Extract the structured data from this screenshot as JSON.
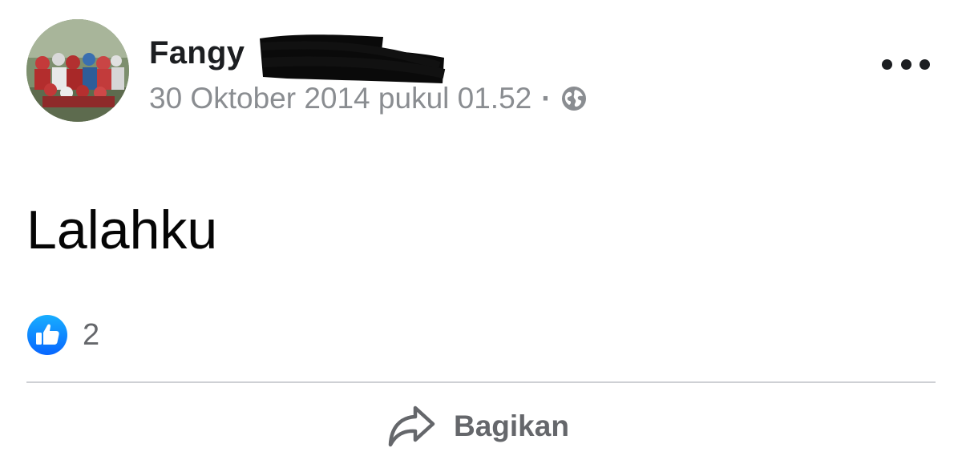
{
  "post": {
    "author": {
      "name": "Fangy"
    },
    "meta": {
      "timestamp": "30 Oktober 2014 pukul 01.52",
      "separator": "·",
      "audience_icon": "globe-icon"
    },
    "more_icon": "more-horizontal-icon",
    "text": "Lalahku",
    "reactions": {
      "icon": "like-icon",
      "count": "2"
    },
    "actions": {
      "share_label": "Bagikan",
      "share_icon": "share-arrow-icon"
    }
  },
  "colors": {
    "like_blue": "#1877f2",
    "meta_gray": "#8a8d91",
    "action_gray": "#65676b",
    "divider": "#ced0d4",
    "text_dark": "#050505"
  }
}
